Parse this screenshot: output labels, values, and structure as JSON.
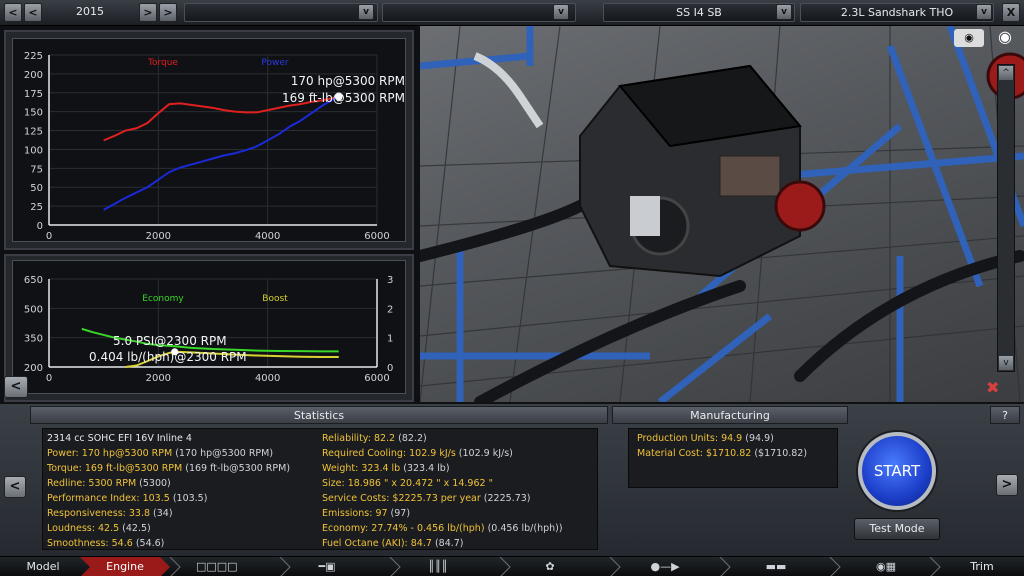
{
  "topbar": {
    "year": "2015",
    "dropdown1": "",
    "dropdown2": "",
    "family": "SS I4 SB",
    "variant": "2.3L Sandshark THO",
    "prev": "<",
    "next": ">",
    "open": "v",
    "close": "X"
  },
  "torque_chart": {
    "series_labels": [
      "Torque",
      "Power"
    ],
    "annotation_power": "170 hp@5300 RPM",
    "annotation_torque": "169 ft-lb@5300 RPM",
    "y_ticks": [
      "225",
      "200",
      "175",
      "150",
      "125",
      "100",
      "75",
      "50",
      "25",
      "0"
    ],
    "x_ticks": [
      "0",
      "2000",
      "4000",
      "6000"
    ]
  },
  "econ_chart": {
    "series_labels": [
      "Economy",
      "Boost"
    ],
    "annotation_boost": "5.0 PSI@2300 RPM",
    "annotation_economy": "0.404 lb/(hph)@2300 RPM",
    "y_ticks_left": [
      "650",
      "500",
      "350",
      "200"
    ],
    "y_ticks_right": [
      "3",
      "2",
      "1",
      "0"
    ],
    "x_ticks": [
      "0",
      "2000",
      "4000",
      "6000"
    ]
  },
  "chart_data": [
    {
      "type": "line",
      "x": [
        1000,
        1200,
        1400,
        1600,
        1800,
        2000,
        2200,
        2400,
        2600,
        2800,
        3000,
        3200,
        3400,
        3600,
        3800,
        4000,
        4200,
        4400,
        4600,
        4800,
        5000,
        5200,
        5300
      ],
      "series": [
        {
          "name": "Torque",
          "color": "#e02020",
          "values": [
            112,
            118,
            125,
            128,
            135,
            148,
            160,
            161,
            159,
            157,
            155,
            152,
            150,
            149,
            149,
            152,
            155,
            158,
            160,
            163,
            165,
            168,
            169
          ]
        },
        {
          "name": "Power",
          "color": "#1a2ad8",
          "values": [
            20,
            28,
            36,
            43,
            50,
            60,
            70,
            76,
            80,
            84,
            88,
            92,
            95,
            99,
            104,
            112,
            120,
            130,
            138,
            148,
            158,
            166,
            170
          ]
        }
      ],
      "ylim": [
        0,
        225
      ],
      "xlim": [
        0,
        6000
      ],
      "grid": true
    },
    {
      "type": "line",
      "x": [
        600,
        800,
        1000,
        1200,
        1400,
        1600,
        1800,
        2000,
        2200,
        2300,
        2600,
        3000,
        3400,
        3800,
        4200,
        4600,
        5000,
        5300
      ],
      "series": [
        {
          "name": "Economy",
          "color": "#3ad62a",
          "axis": "left",
          "values": [
            395,
            378,
            364,
            350,
            340,
            330,
            318,
            312,
            308,
            306,
            298,
            292,
            288,
            284,
            282,
            281,
            280,
            280
          ]
        },
        {
          "name": "Boost",
          "color": "#d8d232",
          "axis": "right",
          "values": [
            null,
            null,
            null,
            null,
            0.0,
            0.05,
            0.2,
            0.36,
            0.48,
            0.52,
            0.5,
            0.46,
            0.42,
            0.39,
            0.37,
            0.35,
            0.34,
            0.34
          ]
        }
      ],
      "ylim": [
        200,
        650
      ],
      "y2lim": [
        0,
        3
      ],
      "xlim": [
        0,
        6000
      ],
      "grid": true
    }
  ],
  "statistics": {
    "title": "Statistics",
    "left": [
      {
        "label": "2314 cc SOHC EFI 16V Inline 4",
        "extra": ""
      },
      {
        "label": "Power: 170 hp@5300 RPM",
        "extra": " (170 hp@5300 RPM)"
      },
      {
        "label": "Torque: 169 ft-lb@5300 RPM",
        "extra": " (169 ft-lb@5300 RPM)"
      },
      {
        "label": "Redline: 5300 RPM",
        "extra": " (5300)"
      },
      {
        "label": "Performance Index: 103.5",
        "extra": " (103.5)"
      },
      {
        "label": "Responsiveness: 33.8",
        "extra": " (34)"
      },
      {
        "label": "Loudness: 42.5",
        "extra": " (42.5)"
      },
      {
        "label": "Smoothness: 54.6",
        "extra": " (54.6)"
      }
    ],
    "right": [
      {
        "label": "Reliability: 82.2",
        "extra": " (82.2)"
      },
      {
        "label": "Required Cooling: 102.9 kJ/s",
        "extra": " (102.9 kJ/s)"
      },
      {
        "label": "Weight: 323.4 lb",
        "extra": " (323.4 lb)"
      },
      {
        "label": "Size: 18.986 \" x 20.472 \" x 14.962 \"",
        "extra": ""
      },
      {
        "label": "Service Costs: $2225.73 per year",
        "extra": " (2225.73)"
      },
      {
        "label": "Emissions: 97",
        "extra": " (97)"
      },
      {
        "label": "Economy: 27.74% - 0.456 lb/(hph)",
        "extra": " (0.456 lb/(hph))"
      },
      {
        "label": "Fuel Octane (AKI): 84.7",
        "extra": " (84.7)"
      }
    ]
  },
  "manufacturing": {
    "title": "Manufacturing",
    "items": [
      {
        "label": "Production Units: 94.9",
        "extra": " (94.9)"
      },
      {
        "label": "Material Cost: $1710.82",
        "extra": " ($1710.82)"
      }
    ]
  },
  "controls": {
    "start": "START",
    "test_mode": "Test Mode",
    "help": "?",
    "left_arrow": "<",
    "right_arrow": ">"
  },
  "tabs": {
    "model": "Model",
    "engine": "Engine",
    "trim": "Trim"
  },
  "colors": {
    "accent_active_tab": "#9a1a1a",
    "stat_yellow": "#f0c238",
    "start_blue": "#1c3ec8"
  }
}
